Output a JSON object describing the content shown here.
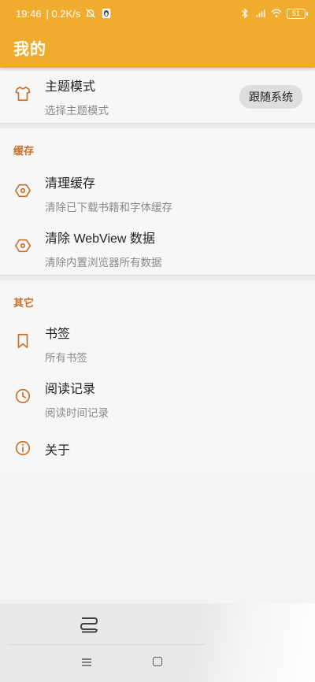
{
  "status_bar": {
    "time": "19:46",
    "network_speed": "| 0.2K/s",
    "battery_level": "51"
  },
  "appbar": {
    "title": "我的"
  },
  "theme": {
    "title": "主题模式",
    "summary": "选择主题模式",
    "value": "跟随系统"
  },
  "cache_section": {
    "category": "缓存",
    "items": [
      {
        "title": "清理缓存",
        "summary": "清除已下载书籍和字体缓存"
      },
      {
        "title": "清除 WebView 数据",
        "summary": "清除内置浏览器所有数据"
      }
    ]
  },
  "other_section": {
    "category": "其它",
    "items": [
      {
        "title": "书签",
        "summary": "所有书签"
      },
      {
        "title": "阅读记录",
        "summary": "阅读时间记录"
      },
      {
        "title": "关于"
      }
    ]
  },
  "colors": {
    "accent": "#efac2d",
    "category": "#c7702b",
    "icon": "#c7702b"
  },
  "icons": {
    "theme": "shirt-icon",
    "cache": "hexagon-nut-icon",
    "webview": "hexagon-nut-icon",
    "bookmark": "bookmark-icon",
    "history": "clock-icon",
    "about": "info-icon",
    "bottom_tab": "bookshelf-icon"
  }
}
